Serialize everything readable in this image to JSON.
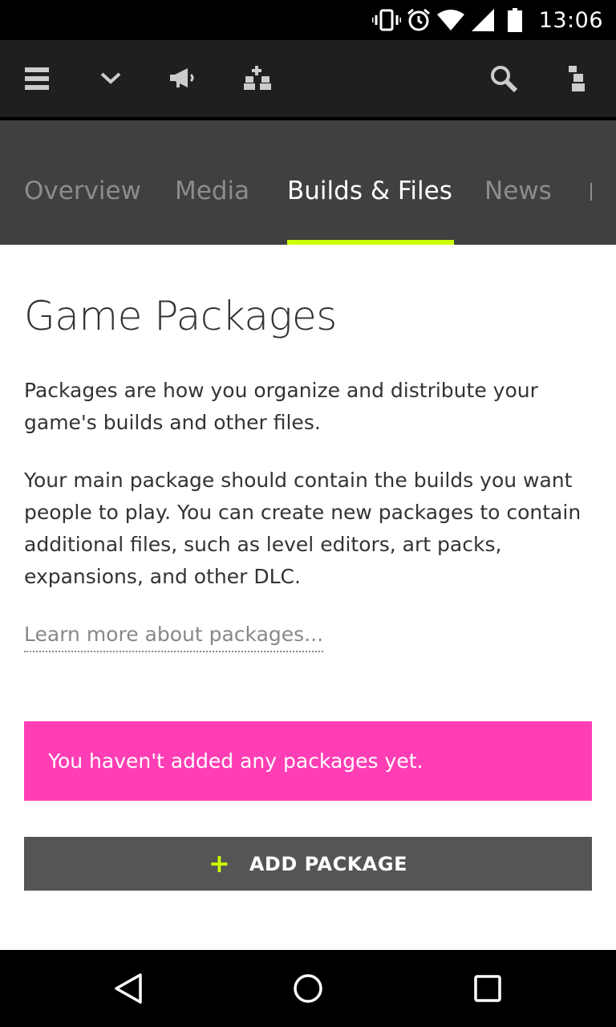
{
  "status_bar": {
    "time": "13:06",
    "icons": [
      "vibrate-icon",
      "alarm-icon",
      "wifi-icon",
      "signal-icon",
      "battery-icon"
    ]
  },
  "toolbar": {
    "icons": [
      "menu-icon",
      "chevron-down-icon",
      "megaphone-icon",
      "people-add-icon",
      "search-icon",
      "user-icon"
    ]
  },
  "tabs": [
    {
      "label": "Overview",
      "active": false
    },
    {
      "label": "Media",
      "active": false
    },
    {
      "label": "Builds & Files",
      "active": true
    },
    {
      "label": "News",
      "active": false
    }
  ],
  "main": {
    "title": "Game Packages",
    "paragraph_1": "Packages are how you organize and distribute your game's builds and other files.",
    "paragraph_2": "Your main package should contain the builds you want people to play. You can create new packages to contain additional files, such as level editors, art packs, expansions, and other DLC.",
    "learn_more_link": "Learn more about packages...",
    "notice": "You haven't added any packages yet.",
    "add_button": {
      "icon": "+",
      "label": "ADD PACKAGE"
    }
  },
  "nav_bar": {
    "icons": [
      "back-icon",
      "home-icon",
      "recents-icon"
    ]
  },
  "colors": {
    "accent": "#ccff00",
    "notice_bg": "#ff3eb5",
    "tabbar_bg": "#404040",
    "toolbar_bg": "#1f1f1f",
    "button_bg": "#555555"
  }
}
